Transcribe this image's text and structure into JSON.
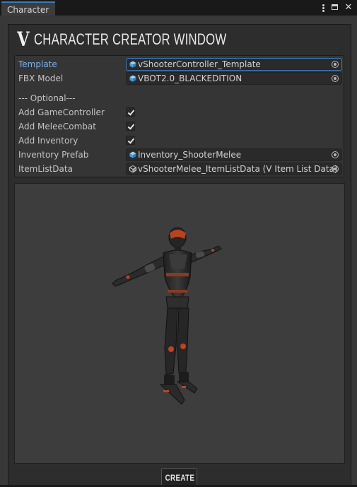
{
  "window": {
    "tab_title": "Character",
    "header_title": "CHARACTER CREATOR WINDOW",
    "accent_color": "#3a79bb"
  },
  "fields": {
    "template": {
      "label": "Template",
      "value": "vShooterController_Template",
      "icon": "prefab-icon"
    },
    "fbx_model": {
      "label": "FBX Model",
      "value": "VBOT2.0_BLACKEDITION",
      "icon": "model-icon"
    },
    "optional_header": "--- Optional---",
    "add_game_controller": {
      "label": "Add GameController",
      "checked": true
    },
    "add_melee_combat": {
      "label": "Add MeleeCombat",
      "checked": true
    },
    "add_inventory": {
      "label": "Add Inventory",
      "checked": true
    },
    "inventory_prefab": {
      "label": "Inventory Prefab",
      "value": "Inventory_ShooterMelee",
      "icon": "prefab-icon"
    },
    "item_list_data": {
      "label": "ItemListData",
      "value": "vShooterMelee_ItemListData (V Item List Data)",
      "icon": "scriptable-object-icon"
    }
  },
  "preview": {
    "model": "VBOT2.0_BLACKEDITION",
    "pose": "T-pose",
    "accent_color": "#c0431f"
  },
  "actions": {
    "create_label": "CREATE"
  }
}
